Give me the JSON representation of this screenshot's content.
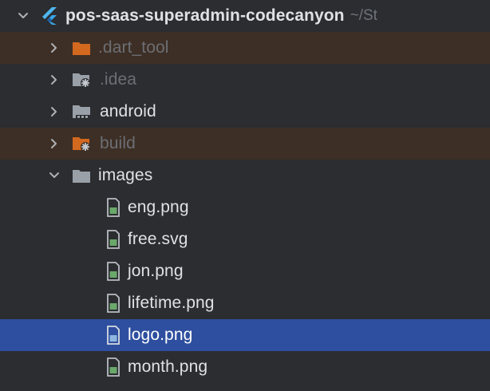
{
  "project": {
    "name": "pos-saas-superadmin-codecanyon",
    "path": "~/St"
  },
  "tree": {
    "folders": {
      "dart_tool": ".dart_tool",
      "idea": ".idea",
      "android": "android",
      "build": "build",
      "images": "images"
    },
    "files": [
      "eng.png",
      "free.svg",
      "jon.png",
      "lifetime.png",
      "logo.png",
      "month.png"
    ],
    "selected_file": "logo.png"
  },
  "colors": {
    "background": "#2b2d30",
    "excluded_row": "#3d2f25",
    "selected_row": "#2e4f9f",
    "excluded_text": "#6c6e74",
    "orange_folder": "#d3681f",
    "flutter_logo": "#4fb7ee"
  },
  "icons": {
    "collapsed": "chevron-right-icon",
    "expanded": "chevron-down-icon",
    "project": "flutter-icon",
    "excluded_folder": "orange-folder-icon",
    "config_folder": "idea-folder-icon",
    "module_folder": "android-folder-icon",
    "build_folder": "build-folder-icon",
    "plain_folder": "folder-icon",
    "image_file": "image-file-icon"
  }
}
